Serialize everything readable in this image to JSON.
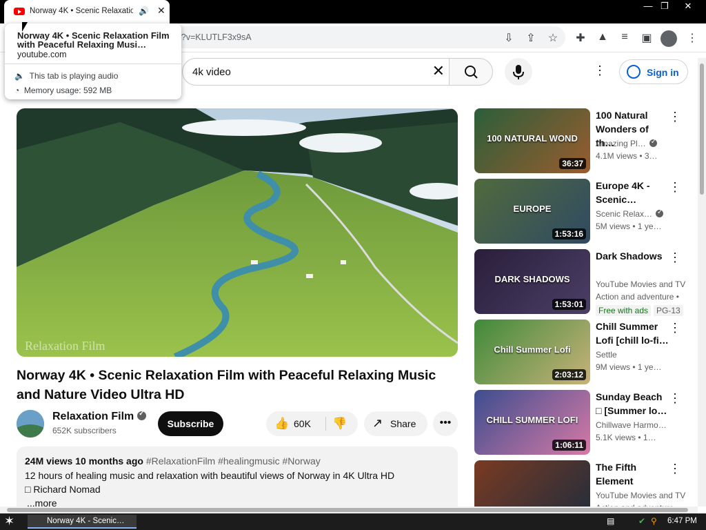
{
  "browser": {
    "tab_title": "Norway 4K • Scenic Relaxation",
    "url_fragment": "i?v=KLUTLF3x9sA",
    "hovercard": {
      "title": "Norway 4K • Scenic Relaxation Film with Peaceful Relaxing Musi…",
      "domain": "youtube.com",
      "audio_status": "This tab is playing audio",
      "memory": "Memory usage: 592 MB"
    }
  },
  "youtube": {
    "search_value": "4k video",
    "signin_label": "Sign in"
  },
  "video": {
    "title": "Norway 4K • Scenic Relaxation Film with Peaceful Relaxing Music and Nature Video Ultra HD",
    "watermark": "Relaxation Film",
    "channel": "Relaxation Film",
    "subscribers": "652K subscribers",
    "subscribe_label": "Subscribe",
    "likes": "60K",
    "share_label": "Share",
    "views_date": "24M views  10 months ago",
    "hashtags": "#RelaxationFilm #healingmusic #Norway",
    "desc_line1": "12 hours of healing music and relaxation with beautiful views of Norway in 4K Ultra HD",
    "desc_line2": "□ Richard Nomad",
    "more_label": "...more"
  },
  "recommendations": [
    {
      "title": "100 Natural Wonders of th…",
      "overlay": "100 NATURAL WOND",
      "channel": "Amazing Pl…",
      "verified": true,
      "meta": "4.1M views  • 3…",
      "duration": "36:37",
      "colors": [
        "#2b5e3a",
        "#9a5c2e"
      ]
    },
    {
      "title": "Europe 4K - Scenic…",
      "overlay": "EUROPE",
      "channel": "Scenic Relax…",
      "verified": true,
      "meta": "5M views  • 1 ye…",
      "duration": "1:53:16",
      "colors": [
        "#506a3d",
        "#2f4a63"
      ]
    },
    {
      "title": "Dark Shadows",
      "overlay": "DARK SHADOWS",
      "channel": "YouTube Movies and TV",
      "verified": false,
      "meta": "Action and adventure •",
      "badges": [
        "Free with ads",
        "PG-13"
      ],
      "duration": "1:53:01",
      "colors": [
        "#2a1e3b",
        "#4b3f66"
      ]
    },
    {
      "title": "Chill Summer Lofi [chill lo-fi…",
      "overlay": "Chill Summer Lofi",
      "channel": "Settle",
      "verified": false,
      "meta": "9M views  • 1 ye…",
      "duration": "2:03:12",
      "colors": [
        "#3f8a3a",
        "#c9b27a"
      ]
    },
    {
      "title": "Sunday Beach □ [Summer lo…",
      "overlay": "CHILL SUMMER LOFI",
      "channel": "Chillwave Harmo…",
      "verified": false,
      "meta": "5.1K views  • 1…",
      "duration": "1:06:11",
      "colors": [
        "#3d4d8f",
        "#d77aa6"
      ]
    },
    {
      "title": "The Fifth Element",
      "overlay": "",
      "channel": "YouTube Movies and TV",
      "verified": false,
      "meta": "Action and adventure •",
      "duration": "",
      "colors": [
        "#7a3a22",
        "#1f2d3d"
      ]
    }
  ],
  "taskbar": {
    "task_label": "Norway 4K - Scenic…",
    "clock": "6:47 PM"
  }
}
